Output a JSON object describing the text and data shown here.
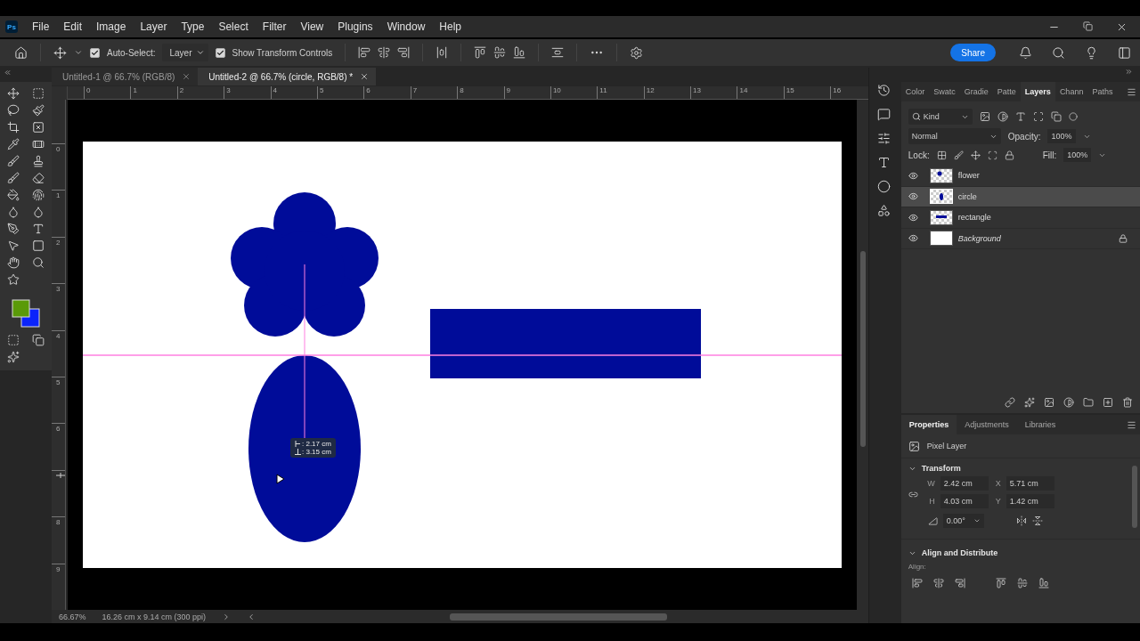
{
  "app": {
    "logo": "Ps"
  },
  "menu": [
    "File",
    "Edit",
    "Image",
    "Layer",
    "Type",
    "Select",
    "Filter",
    "View",
    "Plugins",
    "Window",
    "Help"
  ],
  "options_bar": {
    "auto_select": {
      "label": "Auto-Select:",
      "checked": true
    },
    "target": "Layer",
    "transform_controls": {
      "label": "Show Transform Controls",
      "checked": true
    },
    "share": "Share"
  },
  "document_tabs": [
    {
      "title": "Untitled-1 @ 66.7% (RGB/8)",
      "selected": false
    },
    {
      "title": "Untitled-2 @ 66.7% (circle, RGB/8) *",
      "selected": true
    }
  ],
  "rulers": {
    "horizontal": [
      "0",
      "1",
      "2",
      "3",
      "4",
      "5",
      "6",
      "7",
      "8",
      "9",
      "10",
      "11",
      "12",
      "13",
      "14",
      "15",
      "16"
    ],
    "vertical": [
      {
        "kind": "label",
        "text": "0"
      },
      {
        "kind": "label",
        "text": "1"
      },
      {
        "kind": "label",
        "text": "2"
      },
      {
        "kind": "label",
        "text": "3"
      },
      {
        "kind": "label",
        "text": "4"
      },
      {
        "kind": "label",
        "text": "5"
      },
      {
        "kind": "label",
        "text": "6"
      },
      {
        "kind": "marker"
      },
      {
        "kind": "label",
        "text": "8"
      },
      {
        "kind": "label",
        "text": "9"
      }
    ]
  },
  "canvas": {
    "measurements": [
      {
        "kind": "horizontal",
        "value": ": 2.17 cm"
      },
      {
        "kind": "vertical",
        "value": ": 3.15 cm"
      }
    ]
  },
  "layers_panel": {
    "tabs": [
      {
        "label": "Color",
        "selected": false
      },
      {
        "label": "Swatc",
        "selected": false
      },
      {
        "label": "Gradie",
        "selected": false
      },
      {
        "label": "Patte",
        "selected": false
      },
      {
        "label": "Layers",
        "selected": true
      },
      {
        "label": "Chann",
        "selected": false
      },
      {
        "label": "Paths",
        "selected": false
      }
    ],
    "filter": "Kind",
    "blend_mode": "Normal",
    "opacity_label": "Opacity:",
    "opacity": "100%",
    "lock_label": "Lock:",
    "fill_label": "Fill:",
    "fill": "100%",
    "layers": [
      {
        "name": "flower",
        "kind": "flower",
        "visible": true,
        "selected": false,
        "locked": false
      },
      {
        "name": "circle",
        "kind": "circle",
        "visible": true,
        "selected": true,
        "locked": false
      },
      {
        "name": "rectangle",
        "kind": "rectangle",
        "visible": true,
        "selected": false,
        "locked": false
      },
      {
        "name": "Background",
        "kind": "background",
        "visible": true,
        "selected": false,
        "locked": true
      }
    ]
  },
  "properties_panel": {
    "tabs": [
      {
        "label": "Properties",
        "selected": true
      },
      {
        "label": "Adjustments",
        "selected": false
      },
      {
        "label": "Libraries",
        "selected": false
      }
    ],
    "layer_type": "Pixel Layer",
    "transform": {
      "title": "Transform",
      "expanded": true,
      "fields": [
        {
          "label": "W",
          "value": "2.42 cm"
        },
        {
          "label": "X",
          "value": "5.71 cm"
        },
        {
          "label": "H",
          "value": "4.03 cm"
        },
        {
          "label": "Y",
          "value": "1.42 cm"
        }
      ],
      "angle": "0.00°"
    },
    "align": {
      "title": "Align and Distribute",
      "expanded": true,
      "label": "Align:"
    }
  },
  "status_bar": {
    "zoom": "66.67%",
    "document_size": "16.26 cm x 9.14 cm (300 ppi)"
  }
}
